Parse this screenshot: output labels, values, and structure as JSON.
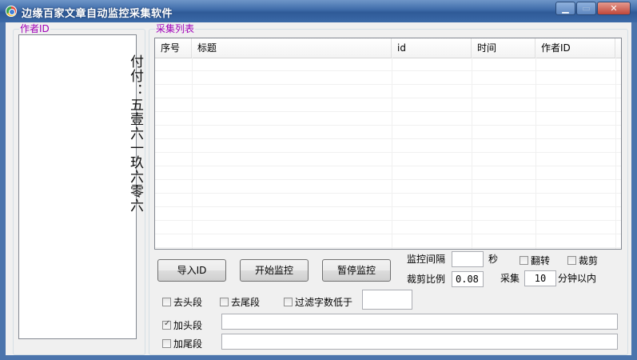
{
  "window": {
    "title": "边缘百家文章自动监控采集软件",
    "min_glyph": "▁",
    "max_glyph": "▭",
    "close_glyph": "✕"
  },
  "author_group": {
    "title": "作者ID",
    "list_text": "付付：五壹六一玖六零六"
  },
  "collect_group": {
    "title": "采集列表",
    "columns": [
      "序号",
      "标题",
      "id",
      "时间",
      "作者ID"
    ],
    "rows": []
  },
  "buttons": {
    "import": "导入ID",
    "start": "开始监控",
    "pause": "暂停监控"
  },
  "settings": {
    "interval_label": "监控间隔",
    "interval_value": "",
    "interval_unit": "秒",
    "flip_label": "翻转",
    "flip_checked": false,
    "crop_label": "裁剪",
    "crop_checked": false,
    "crop_ratio_label": "裁剪比例",
    "crop_ratio_value": "0.08",
    "collect_label": "采集",
    "collect_value": "10",
    "collect_unit": "分钟以内"
  },
  "options": {
    "remove_head": "去头段",
    "remove_head_checked": false,
    "remove_tail": "去尾段",
    "remove_tail_checked": false,
    "filter_label": "过滤字数低于",
    "filter_checked": false,
    "filter_value": "",
    "add_head": "加头段",
    "add_head_checked": true,
    "add_head_value": "",
    "add_tail": "加尾段",
    "add_tail_checked": false,
    "add_tail_value": ""
  }
}
